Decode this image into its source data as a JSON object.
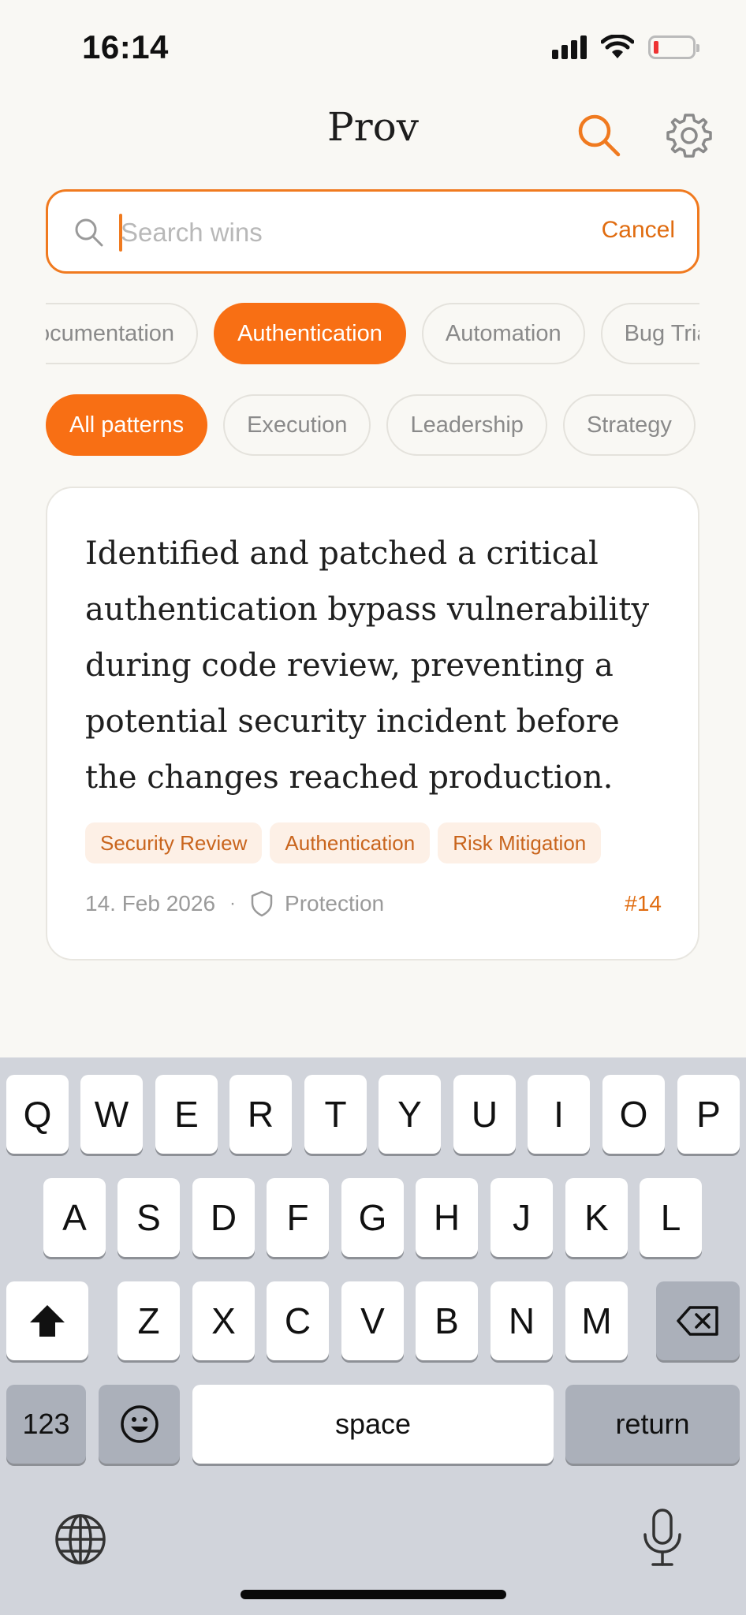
{
  "status_bar": {
    "time": "16:14"
  },
  "header": {
    "title": "Prov"
  },
  "search": {
    "placeholder": "Search wins",
    "value": "",
    "cancel_label": "Cancel"
  },
  "category_chips": [
    {
      "label": "Documentation",
      "active": false
    },
    {
      "label": "Authentication",
      "active": true
    },
    {
      "label": "Automation",
      "active": false
    },
    {
      "label": "Bug Triage",
      "active": false
    }
  ],
  "pattern_chips": [
    {
      "label": "All patterns",
      "active": true
    },
    {
      "label": "Execution",
      "active": false
    },
    {
      "label": "Leadership",
      "active": false
    },
    {
      "label": "Strategy",
      "active": false
    }
  ],
  "win_card": {
    "text": "Identified and patched a critical authentication bypass vulnerability during code review, preventing a potential security incident before the changes reached production.",
    "tags": [
      "Security Review",
      "Authentication",
      "Risk Mitigation"
    ],
    "date": "14. Feb 2026",
    "separator": "·",
    "category": "Protection",
    "category_icon": "shield-icon",
    "number": "#14"
  },
  "keyboard": {
    "row1": [
      "Q",
      "W",
      "E",
      "R",
      "T",
      "Y",
      "U",
      "I",
      "O",
      "P"
    ],
    "row2": [
      "A",
      "S",
      "D",
      "F",
      "G",
      "H",
      "J",
      "K",
      "L"
    ],
    "row3": [
      "Z",
      "X",
      "C",
      "V",
      "B",
      "N",
      "M"
    ],
    "numbers_label": "123",
    "space_label": "space",
    "return_label": "return"
  },
  "colors": {
    "accent": "#f86f14",
    "accent_text": "#e06c10",
    "background": "#f9f8f4",
    "tag_bg": "#fdf0e6"
  }
}
